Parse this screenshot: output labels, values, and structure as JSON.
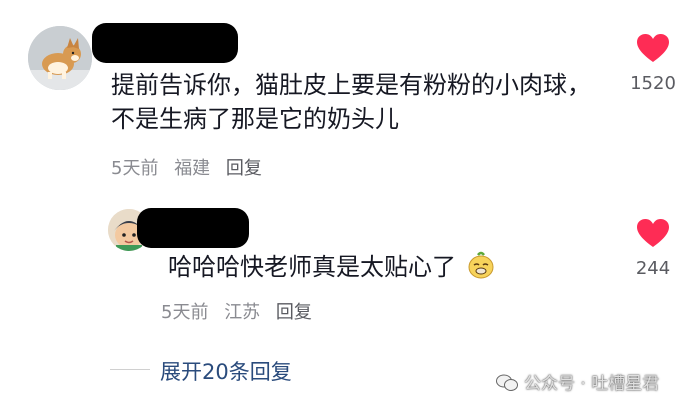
{
  "comment_1": {
    "text": "提前告诉你，猫肚皮上要是有粉粉的小肉球，不是生病了那是它的奶头儿",
    "time": "5天前",
    "location": "福建",
    "reply_label": "回复",
    "likes": "1520"
  },
  "comment_2": {
    "text": "哈哈哈快老师真是太贴心了",
    "emoji": "sly-face-emoji",
    "time": "5天前",
    "location": "江苏",
    "reply_label": "回复",
    "likes": "244"
  },
  "expand_replies_label": "展开20条回复",
  "watermark": "公众号 · 吐槽星君",
  "colors": {
    "like": "#fe2c55",
    "text": "#161823",
    "meta": "#8a8b91",
    "link": "#2a4b7c"
  }
}
